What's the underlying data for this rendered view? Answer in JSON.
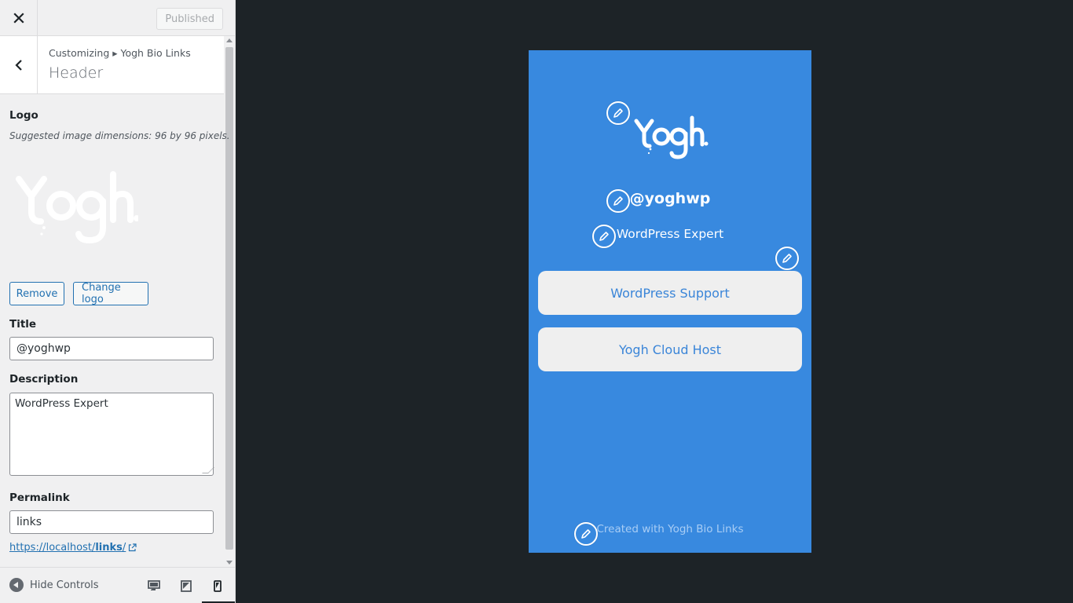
{
  "topbar": {
    "close_icon": "close-icon",
    "publish_label": "Published"
  },
  "section": {
    "breadcrumb": "Customizing ▸ Yogh Bio Links",
    "title": "Header",
    "back_icon": "chevron-left-icon"
  },
  "logo": {
    "label": "Logo",
    "hint": "Suggested image dimensions: 96 by 96 pixels.",
    "remove_label": "Remove",
    "change_label": "Change logo"
  },
  "title_field": {
    "label": "Title",
    "value": "@yoghwp"
  },
  "description_field": {
    "label": "Description",
    "value": "WordPress Expert"
  },
  "permalink_field": {
    "label": "Permalink",
    "value": "links",
    "url_prefix": "https://localhost/",
    "url_slug": "links",
    "url_suffix": "/"
  },
  "footer": {
    "hide_controls_label": "Hide Controls",
    "devices": [
      "desktop",
      "tablet",
      "mobile"
    ],
    "active_device": "mobile"
  },
  "preview": {
    "background_color": "#3889df",
    "title": "@yoghwp",
    "description": "WordPress Expert",
    "links": [
      {
        "label": "WordPress Support"
      },
      {
        "label": "Yogh Cloud Host"
      }
    ],
    "footer_text": "Created with Yogh Bio Links"
  },
  "colors": {
    "accent": "#2271b1",
    "preview_bg": "#3889df",
    "link_button_bg": "#efefef",
    "link_text": "#3a85d8",
    "backdrop": "#1d2327"
  }
}
